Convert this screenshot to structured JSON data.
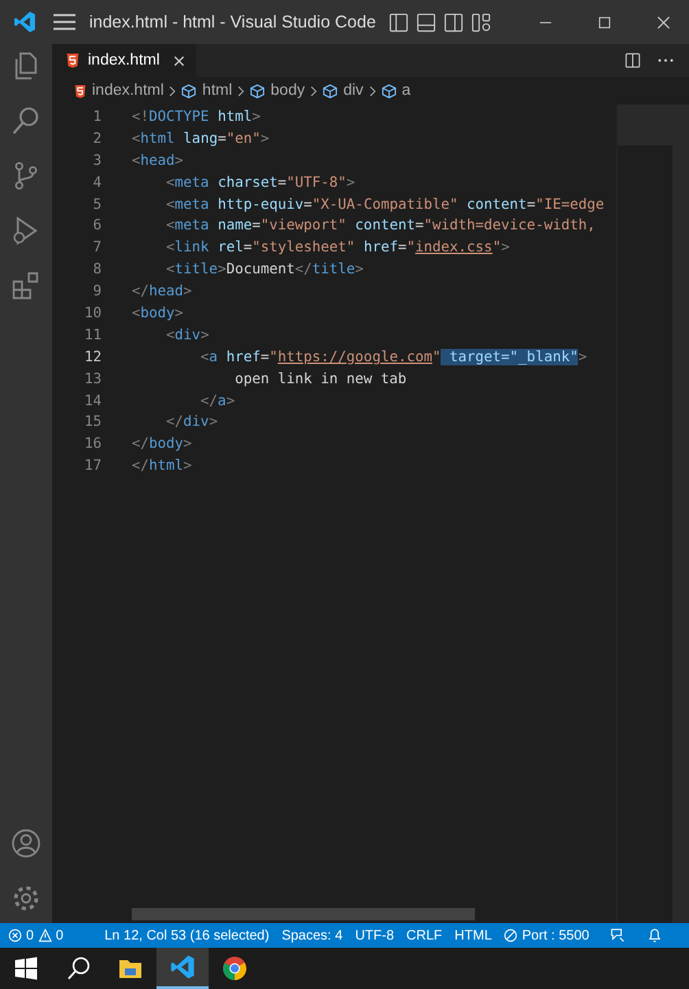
{
  "window": {
    "title": "index.html - html - Visual Studio Code"
  },
  "activity_bar": [
    {
      "kind": "files",
      "selected": false
    },
    {
      "kind": "search",
      "selected": false
    },
    {
      "kind": "source-control",
      "selected": false
    },
    {
      "kind": "run",
      "selected": false
    },
    {
      "kind": "extensions",
      "selected": false
    }
  ],
  "tabs": [
    {
      "label": "index.html",
      "selected": true
    }
  ],
  "breadcrumbs": [
    {
      "kind": "file",
      "label": "index.html"
    },
    {
      "kind": "element",
      "label": "html"
    },
    {
      "kind": "element",
      "label": "body"
    },
    {
      "kind": "element",
      "label": "div"
    },
    {
      "kind": "element",
      "label": "a"
    }
  ],
  "editor": {
    "lines": [
      {
        "number": "1",
        "current": false,
        "tokens": [
          {
            "kind": "punct",
            "text": "<!"
          },
          {
            "kind": "tag",
            "text": "DOCTYPE"
          },
          {
            "kind": "attr",
            "text": " html"
          },
          {
            "kind": "punct",
            "text": ">"
          }
        ]
      },
      {
        "number": "2",
        "current": false,
        "tokens": [
          {
            "kind": "punct",
            "text": "<"
          },
          {
            "kind": "tag",
            "text": "html"
          },
          {
            "kind": "attr",
            "text": " lang"
          },
          {
            "kind": "plain",
            "text": "="
          },
          {
            "kind": "string",
            "text": "\"en\""
          },
          {
            "kind": "punct",
            "text": ">"
          }
        ]
      },
      {
        "number": "3",
        "current": false,
        "tokens": [
          {
            "kind": "punct",
            "text": "<"
          },
          {
            "kind": "tag",
            "text": "head"
          },
          {
            "kind": "punct",
            "text": ">"
          }
        ],
        "children": [
          {
            "number": "4",
            "current": false,
            "tokens": [
              {
                "kind": "punct",
                "text": "<"
              },
              {
                "kind": "tag",
                "text": "meta"
              },
              {
                "kind": "attr",
                "text": " charset"
              },
              {
                "kind": "plain",
                "text": "="
              },
              {
                "kind": "string",
                "text": "\"UTF-8\""
              },
              {
                "kind": "punct",
                "text": ">"
              }
            ]
          },
          {
            "number": "5",
            "current": false,
            "tokens": [
              {
                "kind": "punct",
                "text": "<"
              },
              {
                "kind": "tag",
                "text": "meta"
              },
              {
                "kind": "attr",
                "text": " http-equiv"
              },
              {
                "kind": "plain",
                "text": "="
              },
              {
                "kind": "string",
                "text": "\"X-UA-Compatible\""
              },
              {
                "kind": "attr",
                "text": " content"
              },
              {
                "kind": "plain",
                "text": "="
              },
              {
                "kind": "string",
                "text": "\"IE=edge"
              }
            ]
          },
          {
            "number": "6",
            "current": false,
            "tokens": [
              {
                "kind": "punct",
                "text": "<"
              },
              {
                "kind": "tag",
                "text": "meta"
              },
              {
                "kind": "attr",
                "text": " name"
              },
              {
                "kind": "plain",
                "text": "="
              },
              {
                "kind": "string",
                "text": "\"viewport\""
              },
              {
                "kind": "attr",
                "text": " content"
              },
              {
                "kind": "plain",
                "text": "="
              },
              {
                "kind": "string",
                "text": "\"width=device-width,"
              }
            ]
          },
          {
            "number": "7",
            "current": false,
            "tokens": [
              {
                "kind": "punct",
                "text": "<"
              },
              {
                "kind": "tag",
                "text": "link"
              },
              {
                "kind": "attr",
                "text": " rel"
              },
              {
                "kind": "plain",
                "text": "="
              },
              {
                "kind": "string",
                "text": "\"stylesheet\""
              },
              {
                "kind": "attr",
                "text": " href"
              },
              {
                "kind": "plain",
                "text": "="
              },
              {
                "kind": "string",
                "text": "\""
              },
              {
                "kind": "link",
                "text": "index.css"
              },
              {
                "kind": "string",
                "text": "\""
              },
              {
                "kind": "punct",
                "text": ">"
              }
            ]
          },
          {
            "number": "8",
            "current": false,
            "tokens": [
              {
                "kind": "punct",
                "text": "<"
              },
              {
                "kind": "tag",
                "text": "title"
              },
              {
                "kind": "punct",
                "text": ">"
              },
              {
                "kind": "plain",
                "text": "Document"
              },
              {
                "kind": "punct",
                "text": "</"
              },
              {
                "kind": "tag",
                "text": "title"
              },
              {
                "kind": "punct",
                "text": ">"
              }
            ]
          }
        ]
      },
      {
        "number": "9",
        "current": false,
        "tokens": [
          {
            "kind": "punct",
            "text": "</"
          },
          {
            "kind": "tag",
            "text": "head"
          },
          {
            "kind": "punct",
            "text": ">"
          }
        ]
      },
      {
        "number": "10",
        "current": false,
        "tokens": [
          {
            "kind": "punct",
            "text": "<"
          },
          {
            "kind": "tag",
            "text": "body"
          },
          {
            "kind": "punct",
            "text": ">"
          }
        ],
        "children": [
          {
            "number": "11",
            "current": false,
            "tokens": [
              {
                "kind": "punct",
                "text": "<"
              },
              {
                "kind": "tag",
                "text": "div"
              },
              {
                "kind": "punct",
                "text": ">"
              }
            ],
            "children": [
              {
                "number": "12",
                "current": true,
                "tokens": [
                  {
                    "kind": "punct",
                    "text": "<"
                  },
                  {
                    "kind": "tag",
                    "text": "a"
                  },
                  {
                    "kind": "attr",
                    "text": " href"
                  },
                  {
                    "kind": "plain",
                    "text": "="
                  },
                  {
                    "kind": "string",
                    "text": "\""
                  },
                  {
                    "kind": "link",
                    "text": "https://google.com"
                  },
                  {
                    "kind": "string",
                    "text": "\""
                  },
                  {
                    "kind": "selection",
                    "text": " target=\"_blank\""
                  },
                  {
                    "kind": "punct",
                    "text": ">"
                  }
                ],
                "children": [
                  {
                    "number": "13",
                    "current": false,
                    "tokens": [
                      {
                        "kind": "plain",
                        "text": "open link in new tab"
                      }
                    ]
                  }
                ]
              },
              {
                "number": "14",
                "current": false,
                "tokens": [
                  {
                    "kind": "punct",
                    "text": "</"
                  },
                  {
                    "kind": "tag",
                    "text": "a"
                  },
                  {
                    "kind": "punct",
                    "text": ">"
                  }
                ]
              }
            ]
          },
          {
            "number": "15",
            "current": false,
            "tokens": [
              {
                "kind": "punct",
                "text": "</"
              },
              {
                "kind": "tag",
                "text": "div"
              },
              {
                "kind": "punct",
                "text": ">"
              }
            ]
          }
        ]
      },
      {
        "number": "16",
        "current": false,
        "tokens": [
          {
            "kind": "punct",
            "text": "</"
          },
          {
            "kind": "tag",
            "text": "body"
          },
          {
            "kind": "punct",
            "text": ">"
          }
        ]
      },
      {
        "number": "17",
        "current": false,
        "tokens": [
          {
            "kind": "punct",
            "text": "</"
          },
          {
            "kind": "tag",
            "text": "html"
          },
          {
            "kind": "punct",
            "text": ">"
          }
        ]
      }
    ]
  },
  "status_bar": {
    "errors": "0",
    "warnings": "0",
    "items": [
      "Ln 12, Col 53 (16 selected)",
      "Spaces: 4",
      "UTF-8",
      "CRLF",
      "HTML"
    ],
    "port": "Port : 5500"
  },
  "taskbar": [
    {
      "kind": "start",
      "selected": false
    },
    {
      "kind": "search",
      "selected": false
    },
    {
      "kind": "explorer",
      "selected": false
    },
    {
      "kind": "vscode",
      "selected": true
    },
    {
      "kind": "chrome",
      "selected": false
    }
  ]
}
